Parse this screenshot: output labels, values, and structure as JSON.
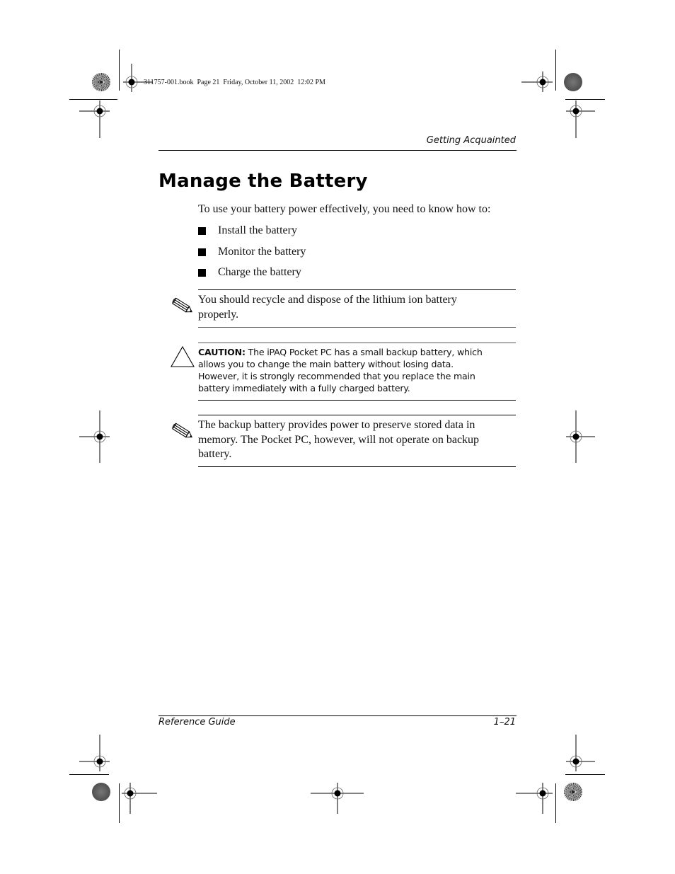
{
  "slug": "311757-001.book  Page 21  Friday, October 11, 2002  12:02 PM",
  "running_head": "Getting Acquainted",
  "section": {
    "title": "Manage the Battery",
    "intro": "To use your battery power effectively, you need to know how to:",
    "bullets": [
      {
        "icon": "square-bullet-icon",
        "text": "Install the battery"
      },
      {
        "icon": "square-bullet-icon",
        "text": "Monitor the battery"
      },
      {
        "icon": "square-bullet-icon",
        "text": "Charge the battery"
      }
    ]
  },
  "notes": [
    {
      "icon": "pencil-note-icon",
      "text": "You should recycle and dispose of the lithium ion battery properly."
    },
    {
      "icon": "pencil-note-icon",
      "text": "The backup battery provides power to preserve stored data in memory. The Pocket PC, however, will not operate on backup battery."
    }
  ],
  "caution": {
    "icon": "caution-triangle-icon",
    "label": "CAUTION:",
    "text": " The iPAQ Pocket PC has a small backup battery, which allows you to change the main battery without losing data. However, it is strongly recommended that you replace the main battery immediately with a fully charged battery."
  },
  "footer": {
    "left": "Reference Guide",
    "right": "1–21"
  },
  "marks": {
    "registration_icon": "registration-mark-icon",
    "color_disc_icon": "color-bar-disc-icon"
  }
}
